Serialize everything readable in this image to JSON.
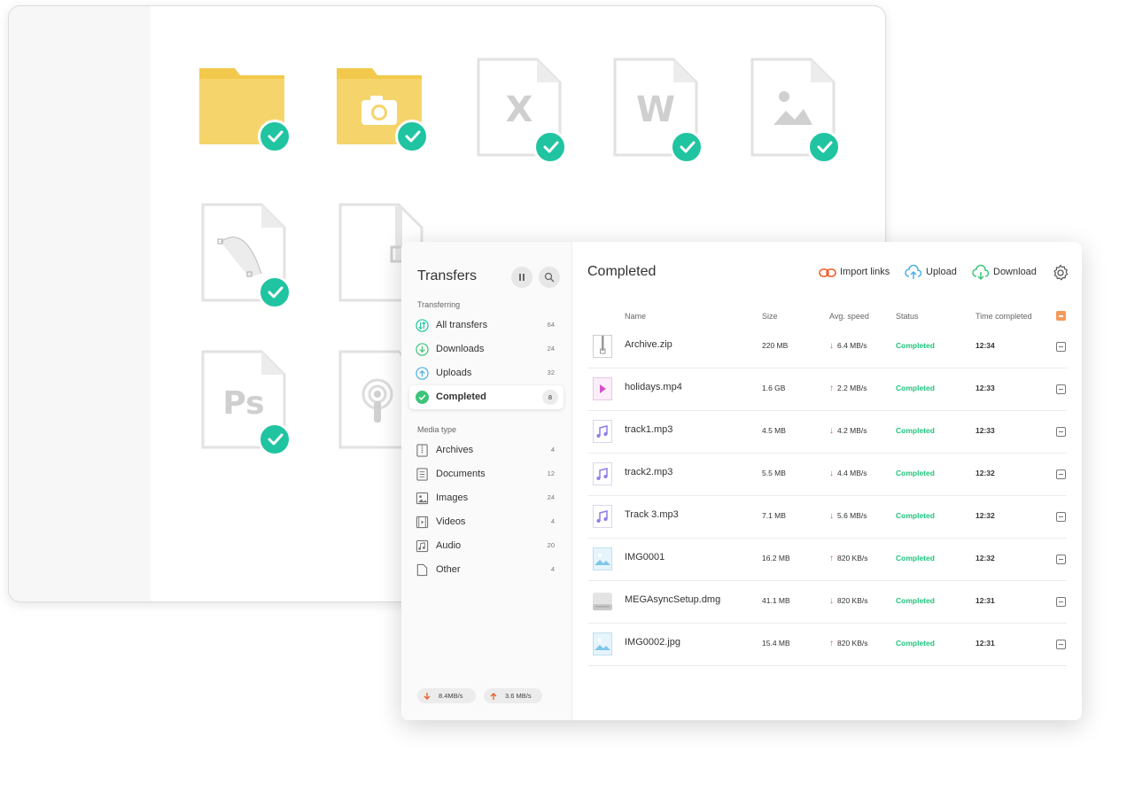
{
  "file_grid": {
    "tiles": [
      {
        "kind": "folder",
        "icon": "folder-icon"
      },
      {
        "kind": "camera-folder",
        "icon": "camera-folder-icon"
      },
      {
        "kind": "doc",
        "letter": "X",
        "icon": "excel-file-icon"
      },
      {
        "kind": "doc",
        "letter": "W",
        "icon": "word-file-icon"
      },
      {
        "kind": "doc",
        "icon": "image-file-icon"
      },
      {
        "kind": "doc",
        "icon": "vector-file-icon"
      },
      {
        "kind": "doc",
        "icon": "archive-file-icon"
      },
      {
        "kind": "doc",
        "letter": "Ps",
        "icon": "photoshop-file-icon"
      },
      {
        "kind": "doc",
        "icon": "podcast-file-icon"
      }
    ],
    "check_color": "#20c4a1",
    "folder_color": "#f5d56b"
  },
  "transfers": {
    "title": "Transfers",
    "pause_icon": "pause-icon",
    "search_icon": "search-icon",
    "section_transferring": "Transferring",
    "nav": [
      {
        "label": "All transfers",
        "count": "64",
        "icon": "all-transfers-icon"
      },
      {
        "label": "Downloads",
        "count": "24",
        "icon": "download-circle-icon"
      },
      {
        "label": "Uploads",
        "count": "32",
        "icon": "upload-circle-icon"
      },
      {
        "label": "Completed",
        "count": "8",
        "icon": "completed-check-icon"
      }
    ],
    "section_media": "Media type",
    "media": [
      {
        "label": "Archives",
        "count": "4",
        "icon": "archive-icon"
      },
      {
        "label": "Documents",
        "count": "12",
        "icon": "document-icon"
      },
      {
        "label": "Images",
        "count": "24",
        "icon": "image-icon"
      },
      {
        "label": "Videos",
        "count": "4",
        "icon": "video-icon"
      },
      {
        "label": "Audio",
        "count": "20",
        "icon": "audio-icon"
      },
      {
        "label": "Other",
        "count": "4",
        "icon": "other-file-icon"
      }
    ],
    "download_speed": "8.4MB/s",
    "upload_speed": "3.6 MB/s"
  },
  "main": {
    "title": "Completed",
    "actions": {
      "import_links": "Import links",
      "upload": "Upload",
      "download": "Download"
    },
    "columns": {
      "name": "Name",
      "size": "Size",
      "speed": "Avg. speed",
      "status": "Status",
      "time": "Time completed"
    },
    "rows": [
      {
        "name": "Archive.zip",
        "size": "220 MB",
        "dir": "down",
        "speed": "6.4 MB/s",
        "status": "Completed",
        "time": "12:34",
        "type": "archive"
      },
      {
        "name": "holidays.mp4",
        "size": "1.6 GB",
        "dir": "up",
        "speed": "2.2 MB/s",
        "status": "Completed",
        "time": "12:33",
        "type": "video"
      },
      {
        "name": "track1.mp3",
        "size": "4.5 MB",
        "dir": "down",
        "speed": "4.2 MB/s",
        "status": "Completed",
        "time": "12:33",
        "type": "audio"
      },
      {
        "name": "track2.mp3",
        "size": "5.5 MB",
        "dir": "down",
        "speed": "4.4 MB/s",
        "status": "Completed",
        "time": "12:32",
        "type": "audio"
      },
      {
        "name": "Track 3.mp3",
        "size": "7.1 MB",
        "dir": "down",
        "speed": "5.6 MB/s",
        "status": "Completed",
        "time": "12:32",
        "type": "audio"
      },
      {
        "name": "IMG0001",
        "size": "16.2 MB",
        "dir": "up",
        "speed": "820 KB/s",
        "status": "Completed",
        "time": "12:32",
        "type": "image"
      },
      {
        "name": "MEGAsyncSetup.dmg",
        "size": "41.1 MB",
        "dir": "down",
        "speed": "820 KB/s",
        "status": "Completed",
        "time": "12:31",
        "type": "disk"
      },
      {
        "name": "IMG0002.jpg",
        "size": "15.4 MB",
        "dir": "up",
        "speed": "820 KB/s",
        "status": "Completed",
        "time": "12:31",
        "type": "image"
      }
    ]
  },
  "colors": {
    "status_green": "#20c47e",
    "download_arrow": "#f15a24",
    "upload_arrow": "#f15a24",
    "accent_orange": "#f59a5b",
    "upload_blue": "#4ab0e6",
    "download_green": "#3cc47a"
  }
}
